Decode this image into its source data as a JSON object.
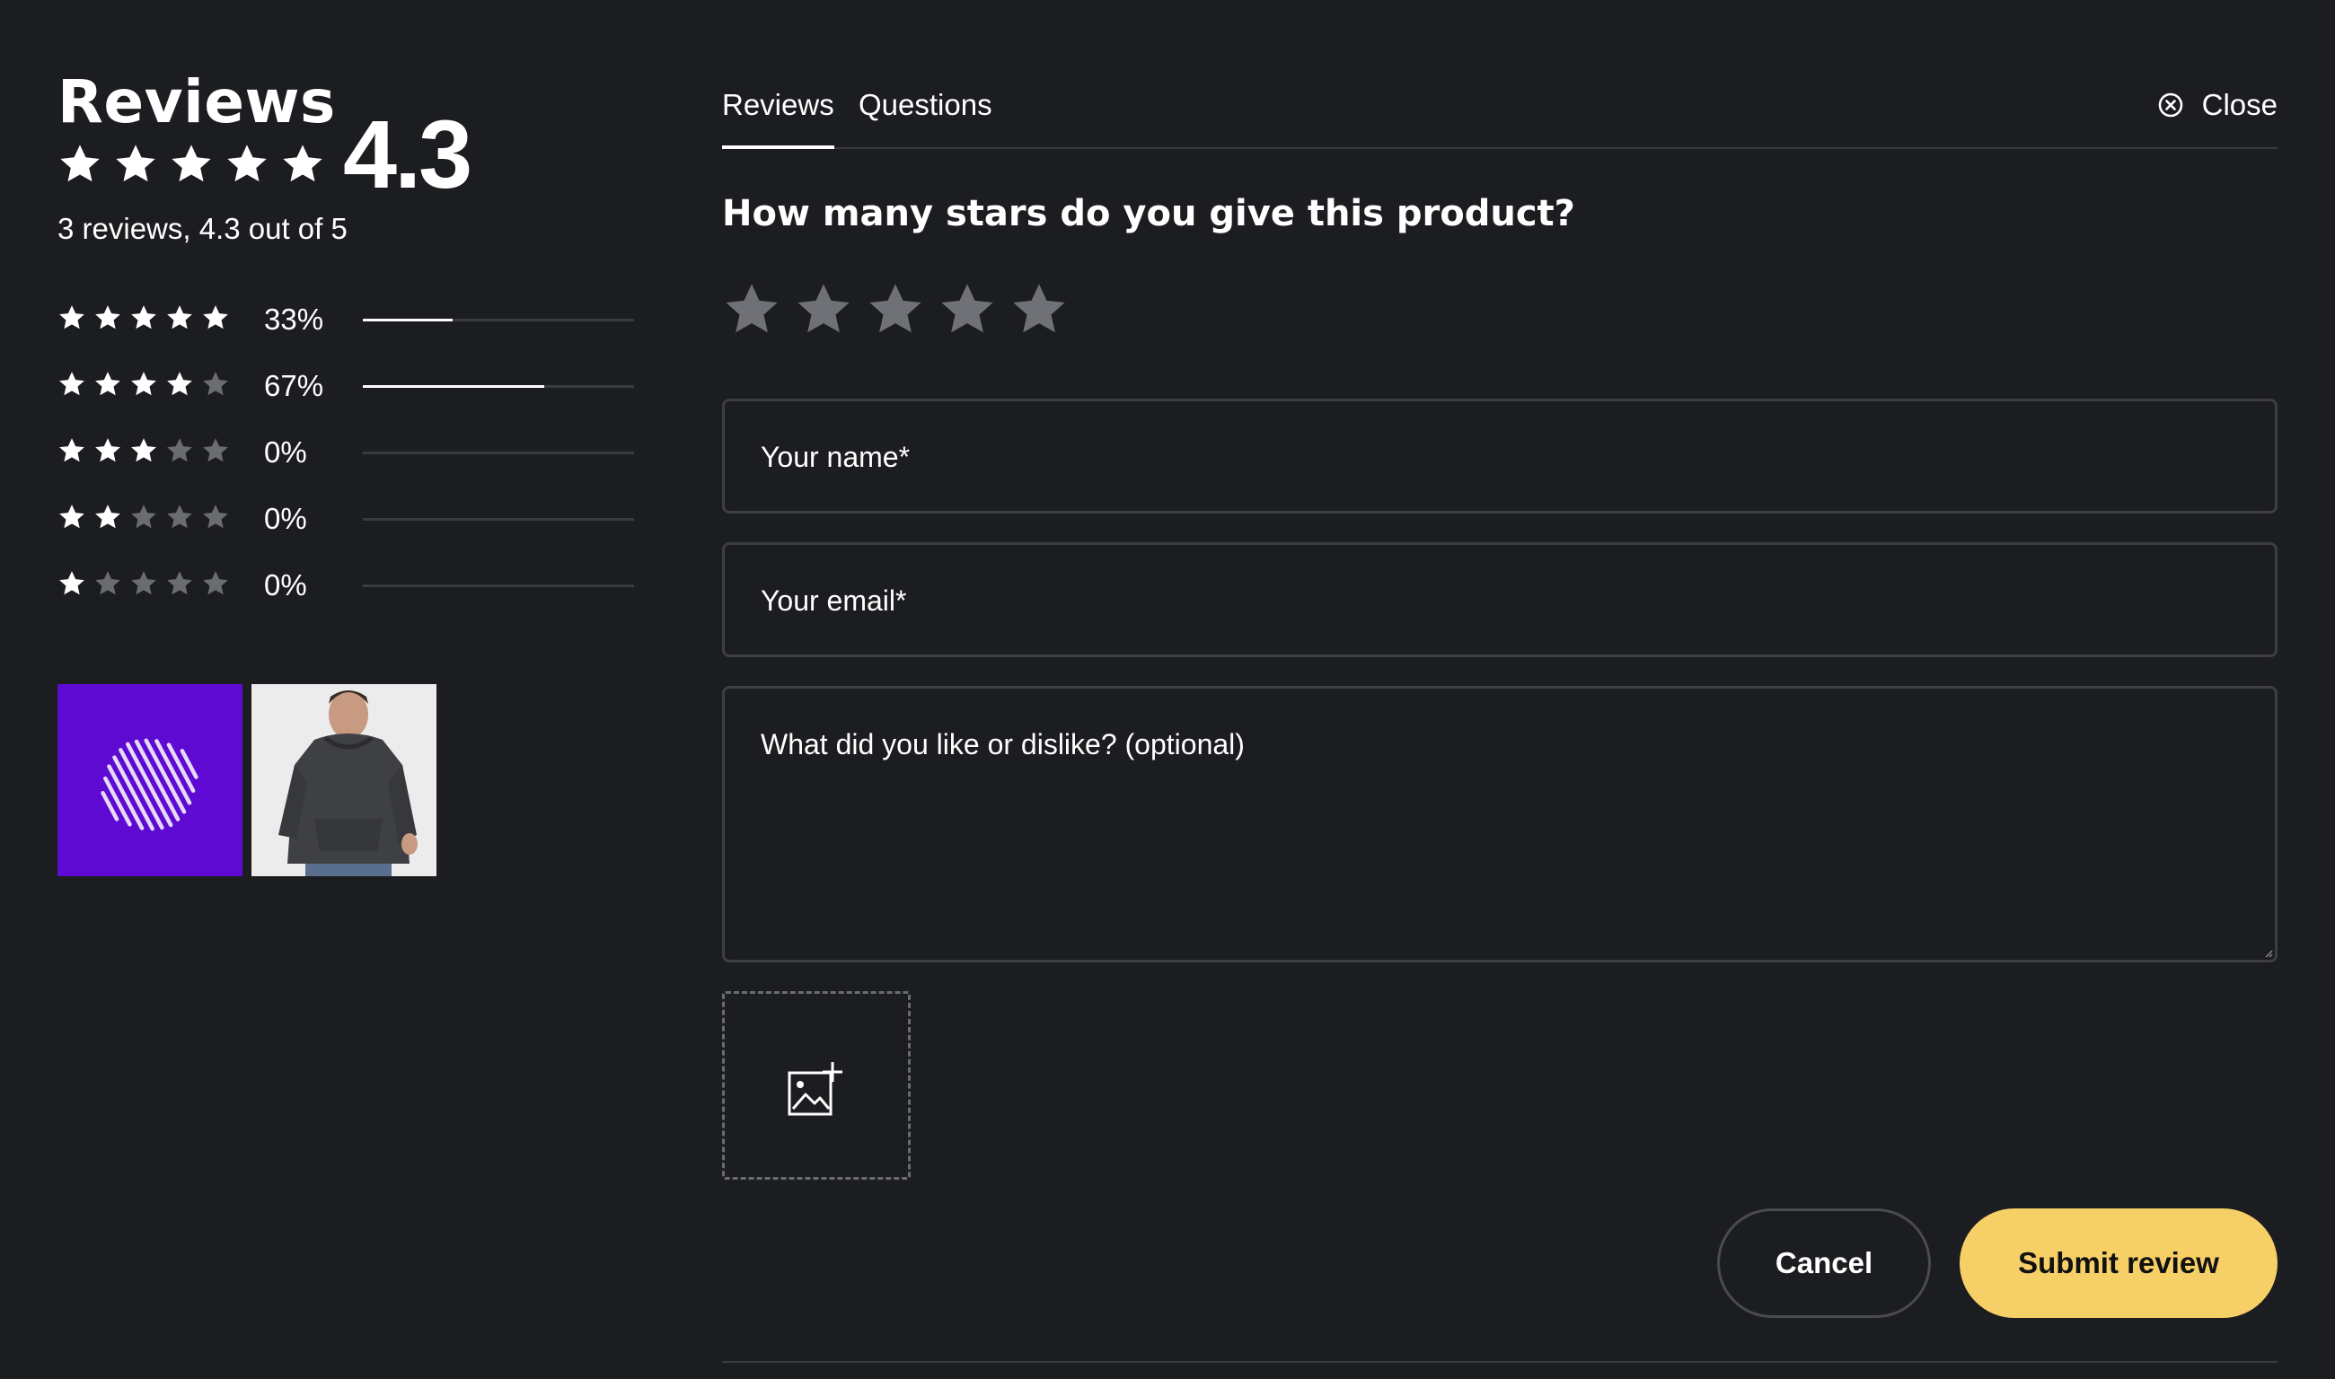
{
  "summary": {
    "title": "Reviews",
    "score": "4.3",
    "stars": [
      1,
      1,
      1,
      1,
      1
    ],
    "text": "3 reviews, 4.3 out of 5",
    "distribution": [
      {
        "stars": 5,
        "percent_label": "33%",
        "fraction": 0.33
      },
      {
        "stars": 4,
        "percent_label": "67%",
        "fraction": 0.67
      },
      {
        "stars": 3,
        "percent_label": "0%",
        "fraction": 0
      },
      {
        "stars": 2,
        "percent_label": "0%",
        "fraction": 0
      },
      {
        "stars": 1,
        "percent_label": "0%",
        "fraction": 0
      }
    ],
    "thumbnails": [
      {
        "name": "brand-logo-thumbnail",
        "kind": "logo"
      },
      {
        "name": "product-photo-thumbnail",
        "kind": "photo"
      }
    ]
  },
  "tabs": [
    {
      "label": "Reviews",
      "active": true
    },
    {
      "label": "Questions",
      "active": false
    }
  ],
  "close": {
    "label": "Close",
    "icon": "close-circle-icon"
  },
  "form": {
    "question": "How many stars do you give this product?",
    "rating_value": 0,
    "name_placeholder": "Your name*",
    "email_placeholder": "Your email*",
    "comment_placeholder": "What did you like or dislike? (optional)",
    "upload_icon": "add-image-icon"
  },
  "actions": {
    "cancel": "Cancel",
    "submit": "Submit review"
  },
  "colors": {
    "background": "#1c1d20",
    "star_filled": "#ffffff",
    "star_empty": "#6b6c71",
    "rating_star": "#707176",
    "field_border": "#3d3e42",
    "submit_bg": "#f6cf67",
    "logo_bg": "#5f0ad3"
  }
}
